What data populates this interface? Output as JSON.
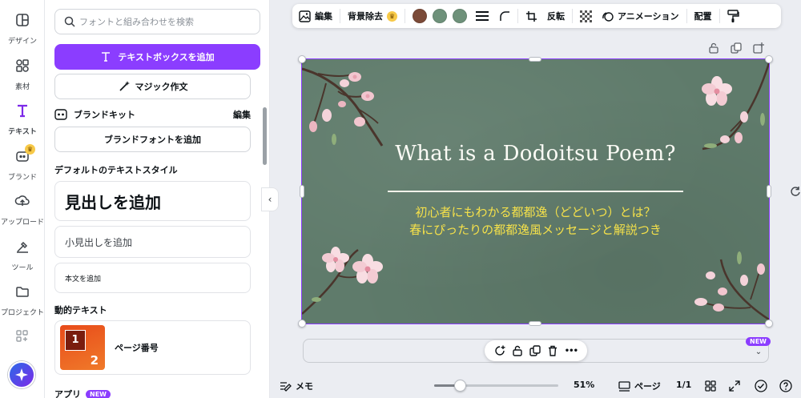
{
  "rail": {
    "items": [
      {
        "label": "デザイン",
        "icon": "layout-icon"
      },
      {
        "label": "素材",
        "icon": "elements-icon"
      },
      {
        "label": "テキスト",
        "icon": "text-icon"
      },
      {
        "label": "ブランド",
        "icon": "brand-icon"
      },
      {
        "label": "アップロード",
        "icon": "upload-icon"
      },
      {
        "label": "ツール",
        "icon": "tools-icon"
      },
      {
        "label": "プロジェクト",
        "icon": "folder-icon"
      }
    ],
    "active": "テキスト",
    "crown_glyph": "♛"
  },
  "panel": {
    "search_placeholder": "フォントと組み合わせを検索",
    "add_textbox": "テキストボックスを追加",
    "magic_write": "マジック作文",
    "brand_kit": "ブランドキット",
    "brand_kit_edit": "編集",
    "add_brand_font": "ブランドフォントを追加",
    "default_styles_title": "デフォルトのテキストスタイル",
    "heading": "見出しを追加",
    "subheading": "小見出しを追加",
    "body": "本文を追加",
    "dynamic_text_title": "動的テキスト",
    "page_number": "ページ番号",
    "thumb_num1": "1",
    "thumb_num2": "2",
    "apps": "アプリ",
    "new": "NEW",
    "collapse_glyph": "‹"
  },
  "toolbar": {
    "edit": "編集",
    "remove_bg": "背景除去",
    "crown_glyph": "♛",
    "swatches": [
      "#7b4a38",
      "#6e917a",
      "#6e917a"
    ],
    "flip": "反転",
    "animate": "アニメーション",
    "position": "配置"
  },
  "design": {
    "title": "What is a  Dodoitsu Poem?",
    "subtitle1": "初心者にもわかる都都逸（どどいつ）とは？",
    "subtitle2": "春にぴったりの都都逸風メッセージと解説つき",
    "bg_color": "#5f7b6b",
    "subtitle_color": "#f5e14a"
  },
  "below": {
    "new": "NEW",
    "more_glyph": "•••",
    "chevron_glyph": "⌄"
  },
  "status": {
    "notes": "メモ",
    "zoom_percent": 51,
    "zoom_label": "51%",
    "pages": "ページ",
    "page_count": "1/1"
  },
  "colors": {
    "accent": "#8b3dff"
  }
}
